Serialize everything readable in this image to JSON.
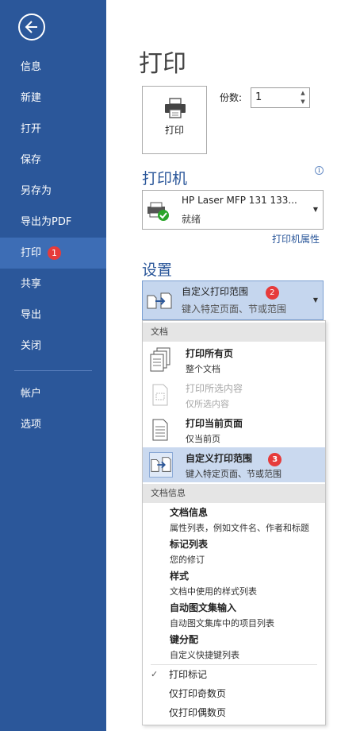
{
  "sidebar": {
    "items": [
      {
        "label": "信息"
      },
      {
        "label": "新建"
      },
      {
        "label": "打开"
      },
      {
        "label": "保存"
      },
      {
        "label": "另存为"
      },
      {
        "label": "导出为PDF"
      },
      {
        "label": "打印",
        "badge": "1"
      },
      {
        "label": "共享"
      },
      {
        "label": "导出"
      },
      {
        "label": "关闭"
      },
      {
        "label": "帐户"
      },
      {
        "label": "选项"
      }
    ]
  },
  "main": {
    "title": "打印",
    "print_button_label": "打印",
    "copies_label": "份数:",
    "copies_value": "1",
    "printer_heading": "打印机",
    "printer": {
      "name": "HP Laser MFP 131 133...",
      "status": "就绪"
    },
    "printer_properties": "打印机属性",
    "settings_heading": "设置",
    "setting_selected": {
      "title": "自定义打印范围",
      "subtitle": "键入特定页面、节或范围",
      "badge": "2"
    }
  },
  "dropdown": {
    "doc_header": "文档",
    "options": [
      {
        "title": "打印所有页",
        "subtitle": "整个文档",
        "icon": "all-pages-icon"
      },
      {
        "title": "打印所选内容",
        "subtitle": "仅所选内容",
        "icon": "selection-icon",
        "disabled": true
      },
      {
        "title": "打印当前页面",
        "subtitle": "仅当前页",
        "icon": "current-page-icon"
      },
      {
        "title": "自定义打印范围",
        "subtitle": "键入特定页面、节或范围",
        "icon": "custom-range-icon",
        "badge": "3",
        "selected": true
      }
    ],
    "info_header": "文档信息",
    "info_items": [
      {
        "title": "文档信息",
        "desc": "属性列表，例如文件名、作者和标题"
      },
      {
        "title": "标记列表",
        "desc": "您的修订"
      },
      {
        "title": "样式",
        "desc": "文档中使用的样式列表"
      },
      {
        "title": "自动图文集输入",
        "desc": "自动图文集库中的项目列表"
      },
      {
        "title": "键分配",
        "desc": "自定义快捷键列表"
      }
    ],
    "toggles": [
      {
        "label": "打印标记",
        "checked": true
      },
      {
        "label": "仅打印奇数页",
        "checked": false
      },
      {
        "label": "仅打印偶数页",
        "checked": false
      }
    ]
  },
  "colors": {
    "sidebar": "#2b579a",
    "accent": "#2b579a",
    "badge": "#e63b3b",
    "selected": "#cad9ef"
  }
}
